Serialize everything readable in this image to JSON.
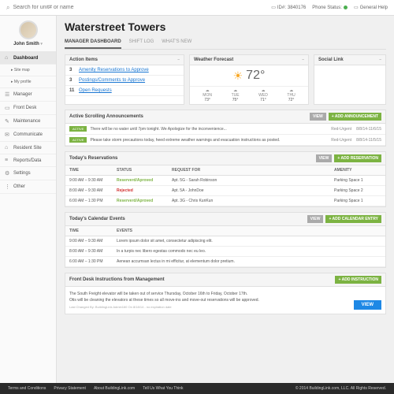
{
  "search": {
    "placeholder": "Search for unit# or name"
  },
  "topbar": {
    "id_label": "ID#:",
    "id": "3840176",
    "phone": "Phone Status:",
    "help": "General Help"
  },
  "user": {
    "name": "John Smith"
  },
  "nav": [
    {
      "label": "Dashboard",
      "icon": "⌂",
      "active": true,
      "subs": [
        "Site map",
        "My profile"
      ]
    },
    {
      "label": "Manager",
      "icon": "☰"
    },
    {
      "label": "Front Desk",
      "icon": "▭"
    },
    {
      "label": "Maintenance",
      "icon": "✎"
    },
    {
      "label": "Communicate",
      "icon": "✉"
    },
    {
      "label": "Resident Site",
      "icon": "⌂"
    },
    {
      "label": "Reports/Data",
      "icon": "≡"
    },
    {
      "label": "Settings",
      "icon": "⚙"
    },
    {
      "label": "Other",
      "icon": "⋮"
    }
  ],
  "title": "Waterstreet Towers",
  "tabs": [
    "MANAGER DASHBOARD",
    "SHIFT LOG",
    "WHAT'S NEW"
  ],
  "action": {
    "title": "Action Items",
    "rows": [
      {
        "n": "3",
        "t": "Amenity Reservations to Approve"
      },
      {
        "n": "3",
        "t": "Postings/Comments to Approve"
      },
      {
        "n": "11",
        "t": "Open Requests"
      }
    ]
  },
  "weather": {
    "title": "Weather Forecast",
    "temp": "72°",
    "days": [
      {
        "d": "MON",
        "t": "73°"
      },
      {
        "d": "TUE",
        "t": "75°"
      },
      {
        "d": "WED",
        "t": "71°"
      },
      {
        "d": "THU",
        "t": "72°"
      }
    ]
  },
  "social": {
    "title": "Social Link"
  },
  "ann": {
    "title": "Active Scrolling Announcements",
    "view": "VIEW",
    "add": "+ ADD ANNOUNCEMENT",
    "rows": [
      {
        "text": "There will be no water until 7pm tonight. We Apologize for the inconvenience...",
        "status": "Red-Urgent",
        "date": "8/8/14-11/6/15"
      },
      {
        "text": "Please take storm precautions today, heed extreme weather warnings and evacuation instructions as posted.",
        "status": "Red-Urgent",
        "date": "8/8/14-11/5/15"
      }
    ]
  },
  "res": {
    "title": "Today's Reservations",
    "view": "VIEW",
    "add": "+ ADD RESERVATION",
    "cols": [
      "TIME",
      "STATUS",
      "REQUEST FOR",
      "AMENITY"
    ],
    "rows": [
      {
        "time": "9:00 AM – 9:30 AM",
        "status": "Reserverd/Aproved",
        "sc": "g",
        "for": "Apt. 5G - Sarah Robinson",
        "am": "Parking Space 1"
      },
      {
        "time": "8:00 AM – 9:30 AM",
        "status": "Rejected",
        "sc": "r",
        "for": "Apt. 5A - JohnDoe",
        "am": "Parking Space 2"
      },
      {
        "time": "6:00 AM – 1:30 PM",
        "status": "Reserverd/Aproved",
        "sc": "g",
        "for": "Apt. 3G - Chris KunKun",
        "am": "Parking Space 1"
      }
    ]
  },
  "cal": {
    "title": "Today's Calendar Events",
    "view": "VIEW",
    "add": "+ ADD CALENDAR ENTRY",
    "cols": [
      "TIME",
      "EVENTS"
    ],
    "rows": [
      {
        "time": "9:00 AM – 9:30 AM",
        "ev": "Lorem ipsum dolor sit amet, consectetur adipiscing elit."
      },
      {
        "time": "8:00 AM – 9:30 AM",
        "ev": "In a turpis nec libero egestas commodo nec eu leo."
      },
      {
        "time": "6:00 AM – 1:30 PM",
        "ev": "Aenean accumsan lectus in mi efficitur, at elementum dolor pretium."
      }
    ]
  },
  "fd": {
    "title": "Front Desk Instructions from Management",
    "add": "+ ADD INSTRUCTION",
    "view": "VIEW",
    "l1": "The South Freight elevator will be taken out of service Thursday, October 16th to Friday, October 17th.",
    "l2": "Otis will be cleaning the elevators at these times so all move-ins and move-out reservations will be approved.",
    "meta": "Last Changed By: BuildingLink Admin160     On 8/18/14 - no expiration date"
  },
  "footer": {
    "links": [
      "Terms and Conditions",
      "Privacy Statement",
      "About BuildingLink.com",
      "Tell Us What You Think"
    ],
    "copy": "© 2014 BuildingLink.com, LLC. All Rights Reserved."
  }
}
